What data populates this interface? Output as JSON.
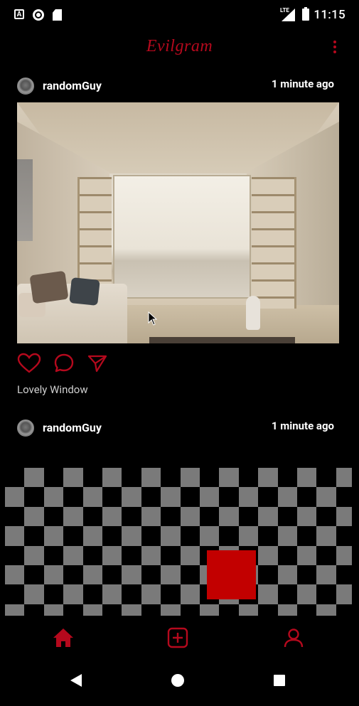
{
  "status_bar": {
    "time": "11:15",
    "network": "LTE",
    "icons": [
      "app-a-icon",
      "record-icon",
      "sd-card-icon",
      "signal-icon",
      "battery-icon"
    ]
  },
  "app": {
    "title": "Evilgram",
    "accent_color": "#b5091d",
    "menu_icon": "more-vert-icon"
  },
  "posts": [
    {
      "username": "randomGuy",
      "time": "1 minute ago",
      "caption": "Lovely Window",
      "actions": [
        "heart-icon",
        "comment-icon",
        "send-icon"
      ]
    },
    {
      "username": "randomGuy",
      "time": "1 minute ago"
    }
  ],
  "bottom_nav": {
    "items": [
      "home-icon",
      "add-post-icon",
      "profile-icon"
    ],
    "active": "home-icon"
  },
  "system_nav": [
    "back-icon",
    "home-circle-icon",
    "recents-icon"
  ],
  "checker_colors": [
    "#7a7a7a",
    "#000000"
  ],
  "red_square_color": "#c20000"
}
